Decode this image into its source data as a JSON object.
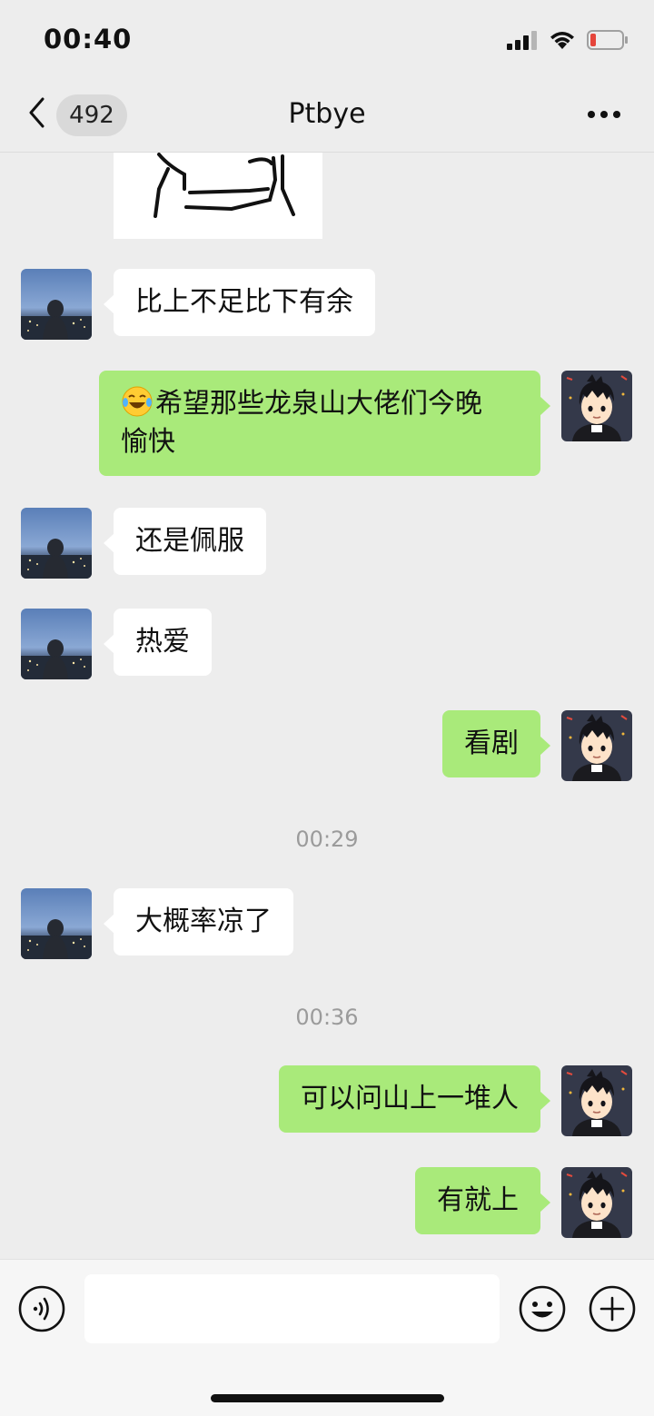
{
  "status_bar": {
    "time": "00:40",
    "icons": [
      "cellular-signal-icon",
      "wifi-icon",
      "battery-low-icon"
    ],
    "battery_level": 0.1
  },
  "nav": {
    "back_icon": "chevron-left-icon",
    "unread_count": "492",
    "title": "Ptbye",
    "more_icon": "ellipsis-icon"
  },
  "messages": [
    {
      "side": "in",
      "type": "image",
      "content": "sketch-drawing"
    },
    {
      "side": "in",
      "type": "text",
      "text": "比上不足比下有余"
    },
    {
      "side": "out",
      "type": "text",
      "emoji": "laughing-tears-emoji",
      "text": "希望那些龙泉山大佬们今晚",
      "text_line2": "愉快"
    },
    {
      "side": "in",
      "type": "text",
      "text": "还是佩服"
    },
    {
      "side": "in",
      "type": "text",
      "text": "热爱"
    },
    {
      "side": "out",
      "type": "text",
      "text": "看剧"
    },
    {
      "type": "timestamp",
      "text": "00:29"
    },
    {
      "side": "in",
      "type": "text",
      "text": "大概率凉了"
    },
    {
      "type": "timestamp",
      "text": "00:36"
    },
    {
      "side": "out",
      "type": "text",
      "text": "可以问山上一堆人"
    },
    {
      "side": "out",
      "type": "text",
      "text": "有就上"
    }
  ],
  "input_bar": {
    "voice_icon": "voice-icon",
    "input_value": "",
    "emoji_icon": "emoji-icon",
    "plus_icon": "plus-icon"
  },
  "colors": {
    "background": "#ededed",
    "incoming_bubble": "#ffffff",
    "outgoing_bubble": "#a9ea7a",
    "timestamp": "#9b9b9b",
    "battery_low": "#e5453b"
  }
}
